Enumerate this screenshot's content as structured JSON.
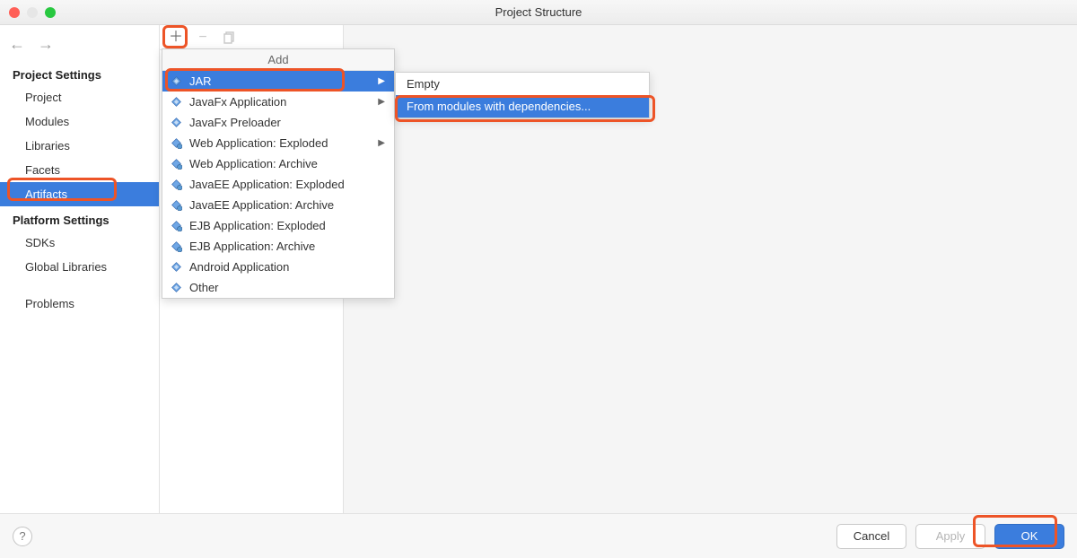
{
  "window": {
    "title": "Project Structure"
  },
  "sidebar": {
    "section1": "Project Settings",
    "items1": [
      "Project",
      "Modules",
      "Libraries",
      "Facets",
      "Artifacts"
    ],
    "section2": "Platform Settings",
    "items2": [
      "SDKs",
      "Global Libraries"
    ],
    "problems": "Problems"
  },
  "toolbar": {
    "add_tooltip": "Add",
    "remove_tooltip": "Remove",
    "copy_tooltip": "Copy"
  },
  "dropdown": {
    "header": "Add",
    "items": [
      {
        "label": "JAR",
        "submenu": true,
        "selected": true
      },
      {
        "label": "JavaFx Application",
        "submenu": true
      },
      {
        "label": "JavaFx Preloader"
      },
      {
        "label": "Web Application: Exploded",
        "submenu": true
      },
      {
        "label": "Web Application: Archive"
      },
      {
        "label": "JavaEE Application: Exploded"
      },
      {
        "label": "JavaEE Application: Archive"
      },
      {
        "label": "EJB Application: Exploded"
      },
      {
        "label": "EJB Application: Archive"
      },
      {
        "label": "Android Application"
      },
      {
        "label": "Other"
      }
    ]
  },
  "submenu": {
    "items": [
      {
        "label": "Empty"
      },
      {
        "label": "From modules with dependencies...",
        "selected": true
      }
    ]
  },
  "buttons": {
    "cancel": "Cancel",
    "apply": "Apply",
    "ok": "OK"
  }
}
